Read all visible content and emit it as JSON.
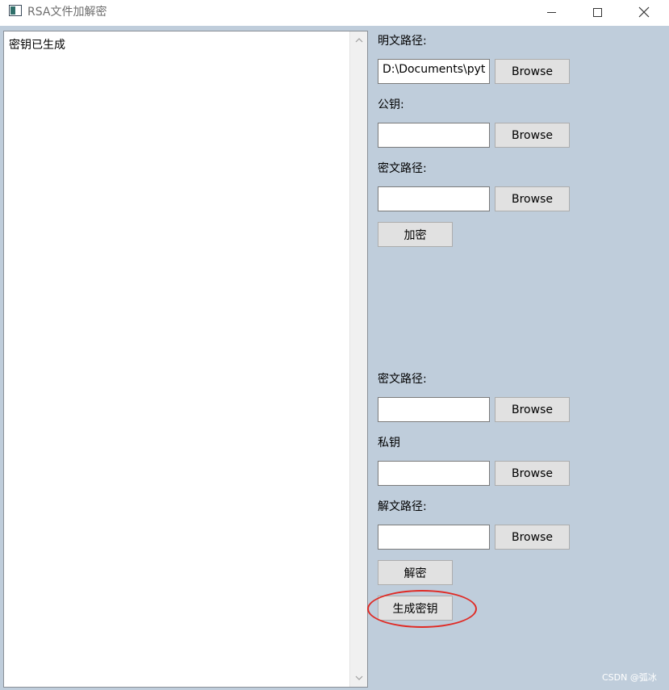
{
  "window": {
    "title": "RSA文件加解密",
    "minimize_icon": "minimize-icon",
    "maximize_icon": "maximize-icon",
    "close_icon": "close-icon"
  },
  "log": {
    "text": "密钥已生成"
  },
  "encrypt": {
    "plain_path_label": "明文路径:",
    "plain_path_value": "D:\\Documents\\pyt",
    "public_key_label": "公钥:",
    "public_key_value": "",
    "cipher_path_label": "密文路径:",
    "cipher_path_value": "",
    "browse_label": "Browse",
    "encrypt_button": "加密"
  },
  "decrypt": {
    "cipher_path_label": "密文路径:",
    "cipher_path_value": "",
    "private_key_label": "私钥",
    "private_key_value": "",
    "decrypted_path_label": "解文路径:",
    "decrypted_path_value": "",
    "browse_label": "Browse",
    "decrypt_button": "解密",
    "generate_keys_button": "生成密钥"
  },
  "annotation": {
    "highlight_color": "#e02a24"
  },
  "watermark": "CSDN @弧冰"
}
